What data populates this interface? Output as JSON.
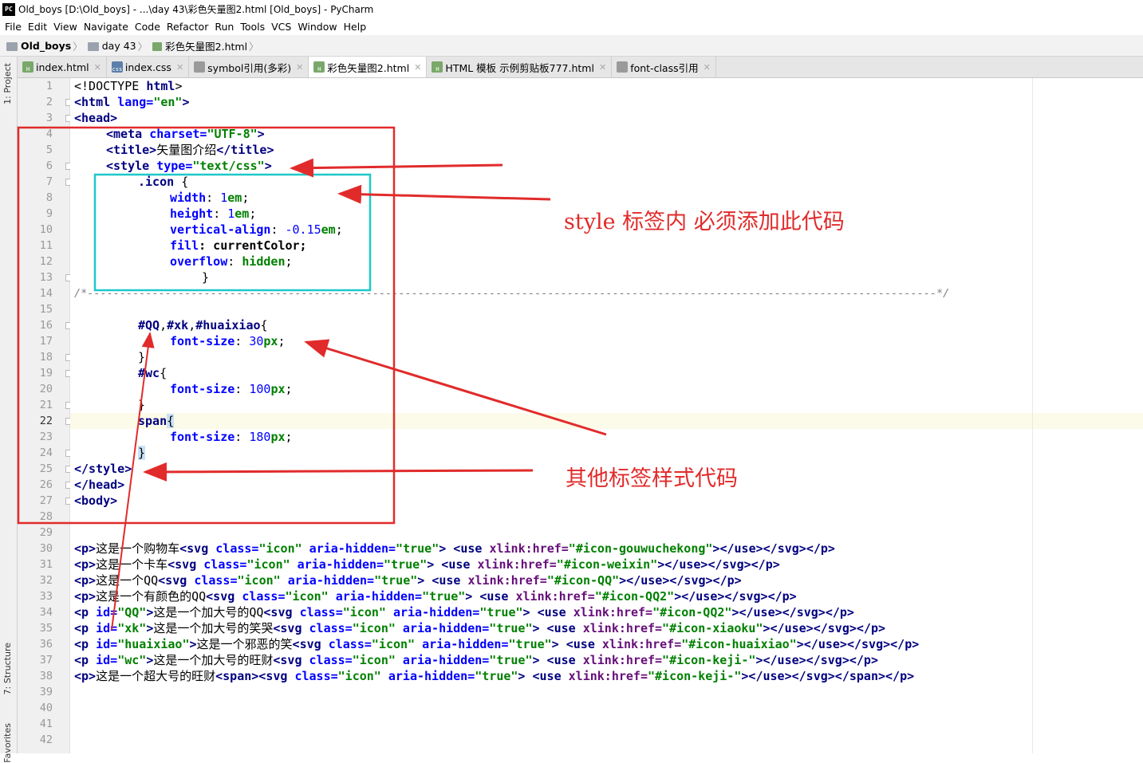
{
  "window": {
    "title": "Old_boys [D:\\Old_boys] - ...\\day 43\\彩色矢量图2.html [Old_boys] - PyCharm",
    "app_icon": "PC"
  },
  "menu": [
    "File",
    "Edit",
    "View",
    "Navigate",
    "Code",
    "Refactor",
    "Run",
    "Tools",
    "VCS",
    "Window",
    "Help"
  ],
  "breadcrumb": [
    "Old_boys",
    "day 43",
    "彩色矢量图2.html"
  ],
  "tabs": [
    {
      "label": "index.html",
      "type": "html"
    },
    {
      "label": "index.css",
      "type": "css"
    },
    {
      "label": "symbol引用(多彩)",
      "type": "file"
    },
    {
      "label": "彩色矢量图2.html",
      "type": "html",
      "active": true
    },
    {
      "label": "HTML 模板 示例剪贴板777.html",
      "type": "html"
    },
    {
      "label": "font-class引用",
      "type": "file"
    }
  ],
  "side_tools": {
    "project": "1: Project",
    "structure": "7: Structure",
    "favorites": "Favorites"
  },
  "line_numbers": [
    "1",
    "2",
    "3",
    "4",
    "5",
    "6",
    "7",
    "8",
    "9",
    "10",
    "11",
    "12",
    "13",
    "14",
    "15",
    "16",
    "17",
    "18",
    "19",
    "20",
    "21",
    "22",
    "23",
    "24",
    "25",
    "26",
    "27",
    "28",
    "29",
    "30",
    "31",
    "32",
    "33",
    "34",
    "35",
    "36",
    "37",
    "38",
    "39",
    "40",
    "41",
    "42"
  ],
  "current_line": 22,
  "code": {
    "l1": {
      "a": "<!DOCTYPE ",
      "b": "html",
      "c": ">"
    },
    "l2": {
      "a": "<html ",
      "b": "lang=",
      "c": "\"en\"",
      "d": ">"
    },
    "l3": {
      "a": "<head>"
    },
    "l4": {
      "a": "<meta ",
      "b": "charset=",
      "c": "\"UTF-8\"",
      "d": ">"
    },
    "l5": {
      "a": "<title>",
      "b": "矢量图介绍",
      "c": "</title>"
    },
    "l6": {
      "a": "<style ",
      "b": "type=",
      "c": "\"text/css\"",
      "d": ">"
    },
    "l7": {
      "a": ".icon ",
      "b": "{"
    },
    "l8": {
      "a": "width",
      "b": ": ",
      "c": "1",
      "d": "em",
      "e": ";"
    },
    "l9": {
      "a": "height",
      "b": ": ",
      "c": "1",
      "d": "em",
      "e": ";"
    },
    "l10": {
      "a": "vertical-align",
      "b": ": ",
      "c": "-0.15",
      "d": "em",
      "e": ";"
    },
    "l11": {
      "a": "fill",
      "b": ": currentColor;"
    },
    "l12": {
      "a": "overflow",
      "b": ": ",
      "c": "hidden",
      "d": ";"
    },
    "l13": {
      "a": "}"
    },
    "l14": {
      "a": "/*",
      "b": "-----------------------------------------------------------------------------------------------------------------------------------",
      "c": "*/"
    },
    "l16": {
      "a": "#QQ",
      "b": ",",
      "c": "#xk",
      "d": ",",
      "e": "#huaixiao",
      "f": "{"
    },
    "l17": {
      "a": "font-size",
      "b": ": ",
      "c": "30",
      "d": "px",
      "e": ";"
    },
    "l18": {
      "a": "}"
    },
    "l19": {
      "a": "#wc",
      "b": "{"
    },
    "l20": {
      "a": "font-size",
      "b": ": ",
      "c": "100",
      "d": "px",
      "e": ";"
    },
    "l21": {
      "a": "}"
    },
    "l22": {
      "a": "span",
      "b": "{"
    },
    "l23": {
      "a": "font-size",
      "b": ": ",
      "c": "180",
      "d": "px",
      "e": ";"
    },
    "l24": {
      "a": "}"
    },
    "l25": {
      "a": "</style>"
    },
    "l26": {
      "a": "</head>"
    },
    "l27": {
      "a": "<body>"
    },
    "l30": {
      "a": "<p>",
      "b": "这是一个购物车",
      "c": "<svg ",
      "d": "class=",
      "e": "\"icon\" ",
      "f": "aria-hidden=",
      "g": "\"true\"",
      "h": "> <use ",
      "i": "xlink:href=",
      "j": "\"#icon-gouwuchekong\"",
      "k": "></use></svg></p>"
    },
    "l31": {
      "a": "<p>",
      "b": "这是一个卡车",
      "c": "<svg ",
      "d": "class=",
      "e": "\"icon\" ",
      "f": "aria-hidden=",
      "g": "\"true\"",
      "h": "> <use ",
      "i": "xlink:href=",
      "j": "\"#icon-weixin\"",
      "k": "></use></svg></p>"
    },
    "l32": {
      "a": "<p>",
      "b": "这是一个QQ",
      "c": "<svg ",
      "d": "class=",
      "e": "\"icon\" ",
      "f": "aria-hidden=",
      "g": "\"true\"",
      "h": "> <use ",
      "i": "xlink:href=",
      "j": "\"#icon-QQ\"",
      "k": "></use></svg></p>"
    },
    "l33": {
      "a": "<p>",
      "b": "这是一个有颜色的QQ",
      "c": "<svg ",
      "d": "class=",
      "e": "\"icon\" ",
      "f": "aria-hidden=",
      "g": "\"true\"",
      "h": "> <use ",
      "i": "xlink:href=",
      "j": "\"#icon-QQ2\"",
      "k": "></use></svg></p>"
    },
    "l34": {
      "a": "<p ",
      "b": "id=",
      "c": "\"QQ\"",
      "d": ">",
      "e": "这是一个加大号的QQ",
      "f": "<svg ",
      "g": "class=",
      "h": "\"icon\" ",
      "i": "aria-hidden=",
      "j": "\"true\"",
      "k": "> <use ",
      "l": "xlink:href=",
      "m": "\"#icon-QQ2\"",
      "n": "></use></svg></p>"
    },
    "l35": {
      "a": "<p ",
      "b": "id=",
      "c": "\"xk\"",
      "d": ">",
      "e": "这是一个加大号的笑哭",
      "f": "<svg ",
      "g": "class=",
      "h": "\"icon\" ",
      "i": "aria-hidden=",
      "j": "\"true\"",
      "k": "> <use ",
      "l": "xlink:href=",
      "m": "\"#icon-xiaoku\"",
      "n": "></use></svg></p>"
    },
    "l36": {
      "a": "<p ",
      "b": "id=",
      "c": "\"huaixiao\"",
      "d": ">",
      "e": "这是一个邪恶的笑",
      "f": "<svg ",
      "g": "class=",
      "h": "\"icon\" ",
      "i": "aria-hidden=",
      "j": "\"true\"",
      "k": "> <use ",
      "l": "xlink:href=",
      "m": "\"#icon-huaixiao\"",
      "n": "></use></svg></p>"
    },
    "l37": {
      "a": "<p ",
      "b": "id=",
      "c": "\"wc\"",
      "d": ">",
      "e": "这是一个加大号的旺财",
      "f": "<svg ",
      "g": "class=",
      "h": "\"icon\" ",
      "i": "aria-hidden=",
      "j": "\"true\"",
      "k": "> <use ",
      "l": "xlink:href=",
      "m": "\"#icon-keji-\"",
      "n": "></use></svg></p>"
    },
    "l38": {
      "a": "<p>",
      "b": "这是一个超大号的旺财",
      "c": "<span><svg ",
      "d": "class=",
      "e": "\"icon\" ",
      "f": "aria-hidden=",
      "g": "\"true\"",
      "h": "> <use ",
      "i": "xlink:href=",
      "j": "\"#icon-keji-\"",
      "k": "></use></svg></span></p>"
    }
  },
  "annotations": {
    "style_note": "style 标签内 必须添加此代码",
    "other_note": "其他标签样式代码",
    "red": "#e12b2b",
    "cyan": "#1ec8c8"
  }
}
